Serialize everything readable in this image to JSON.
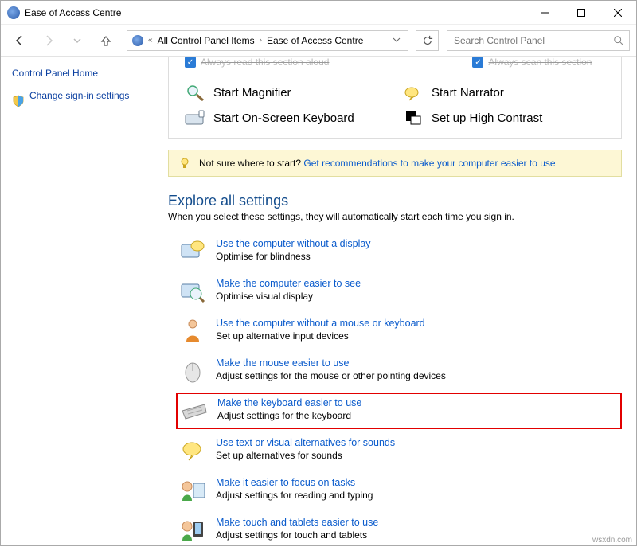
{
  "window": {
    "title": "Ease of Access Centre"
  },
  "breadcrumb": {
    "root": "«",
    "all": "All Control Panel Items",
    "current": "Ease of Access Centre"
  },
  "search": {
    "placeholder": "Search Control Panel"
  },
  "sidebar": {
    "home": "Control Panel Home",
    "signin": "Change sign-in settings"
  },
  "panel": {
    "cut1": "Always read this section aloud",
    "cut2": "Always scan this section",
    "quick": {
      "magnifier": "Start Magnifier",
      "narrator": "Start Narrator",
      "osk": "Start On-Screen Keyboard",
      "contrast": "Set up High Contrast"
    }
  },
  "hint": {
    "lead": "Not sure where to start?",
    "link": "Get recommendations to make your computer easier to use"
  },
  "explore": {
    "heading": "Explore all settings",
    "sub": "When you select these settings, they will automatically start each time you sign in."
  },
  "settings": [
    {
      "link": "Use the computer without a display",
      "desc": "Optimise for blindness"
    },
    {
      "link": "Make the computer easier to see",
      "desc": "Optimise visual display"
    },
    {
      "link": "Use the computer without a mouse or keyboard",
      "desc": "Set up alternative input devices"
    },
    {
      "link": "Make the mouse easier to use",
      "desc": "Adjust settings for the mouse or other pointing devices"
    },
    {
      "link": "Make the keyboard easier to use",
      "desc": "Adjust settings for the keyboard"
    },
    {
      "link": "Use text or visual alternatives for sounds",
      "desc": "Set up alternatives for sounds"
    },
    {
      "link": "Make it easier to focus on tasks",
      "desc": "Adjust settings for reading and typing"
    },
    {
      "link": "Make touch and tablets easier to use",
      "desc": "Adjust settings for touch and tablets"
    }
  ],
  "watermark": "wsxdn.com"
}
